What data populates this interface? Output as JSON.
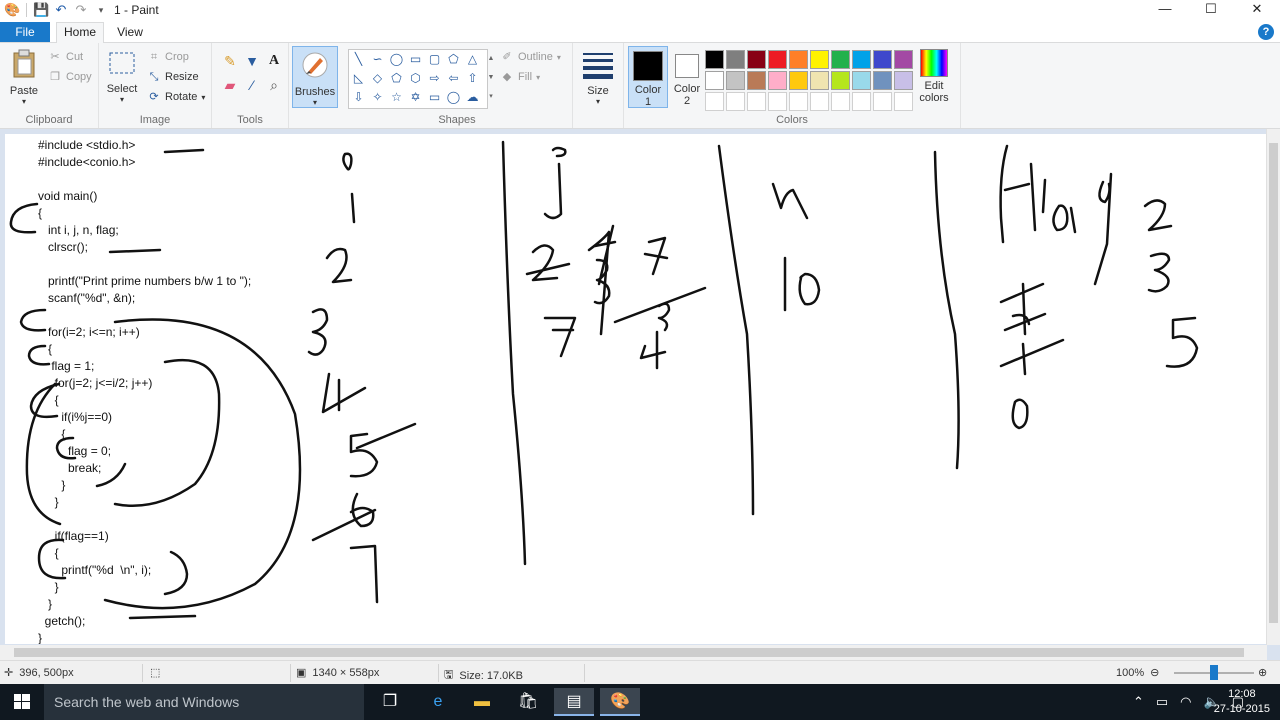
{
  "window": {
    "title": "1 - Paint",
    "controls": {
      "minimize": "—",
      "maximize": "☐",
      "close": "✕"
    }
  },
  "tabs": {
    "file": "File",
    "home": "Home",
    "view": "View"
  },
  "ribbon": {
    "clipboard": {
      "label": "Clipboard",
      "paste": "Paste",
      "cut": "Cut",
      "copy": "Copy"
    },
    "image": {
      "label": "Image",
      "select": "Select",
      "crop": "Crop",
      "resize": "Resize",
      "rotate": "Rotate"
    },
    "tools": {
      "label": "Tools"
    },
    "brushes": {
      "label": "Brushes"
    },
    "shapes": {
      "label": "Shapes",
      "outline": "Outline",
      "fill": "Fill"
    },
    "size": {
      "label": "Size"
    },
    "colors": {
      "label": "Colors",
      "color1": "Color\n1",
      "color2": "Color\n2",
      "edit": "Edit\ncolors",
      "color1_value": "#000000",
      "color2_value": "#ffffff",
      "palette": [
        "#000000",
        "#7f7f7f",
        "#880015",
        "#ed1c24",
        "#ff7f27",
        "#fff200",
        "#22b14c",
        "#00a2e8",
        "#3f48cc",
        "#a349a4",
        "#ffffff",
        "#c3c3c3",
        "#b97a57",
        "#ffaec9",
        "#ffc90e",
        "#efe4b0",
        "#b5e61d",
        "#99d9ea",
        "#7092be",
        "#c8bfe7",
        "#ffffff",
        "#ffffff",
        "#ffffff",
        "#ffffff",
        "#ffffff",
        "#ffffff",
        "#ffffff",
        "#ffffff",
        "#ffffff",
        "#ffffff"
      ]
    }
  },
  "canvas": {
    "code_lines": [
      "#include <stdio.h>",
      "#include<conio.h>",
      "",
      "void main()",
      "{",
      "   int i, j, n, flag;",
      "   clrscr();",
      "",
      "   printf(\"Print prime numbers b/w 1 to \");",
      "   scanf(\"%d\", &n);",
      "",
      "   for(i=2; i<=n; i++)",
      "   {",
      "    flag = 1;",
      "     for(j=2; j<=i/2; j++)",
      "     {",
      "       if(i%j==0)",
      "       {",
      "         flag = 0;",
      "         break;",
      "       }",
      "     }",
      "",
      "     if(flag==1)",
      "     {",
      "       printf(\"%d  \\n\", i);",
      "     }",
      "   }",
      "  getch();",
      "}"
    ]
  },
  "status": {
    "cursor": "396, 500px",
    "canvas_size": "1340 × 558px",
    "file_size": "Size: 17.0KB",
    "zoom": "100%"
  },
  "taskbar": {
    "search_placeholder": "Search the web and Windows",
    "time": "12:08",
    "date": "27-10-2015"
  }
}
